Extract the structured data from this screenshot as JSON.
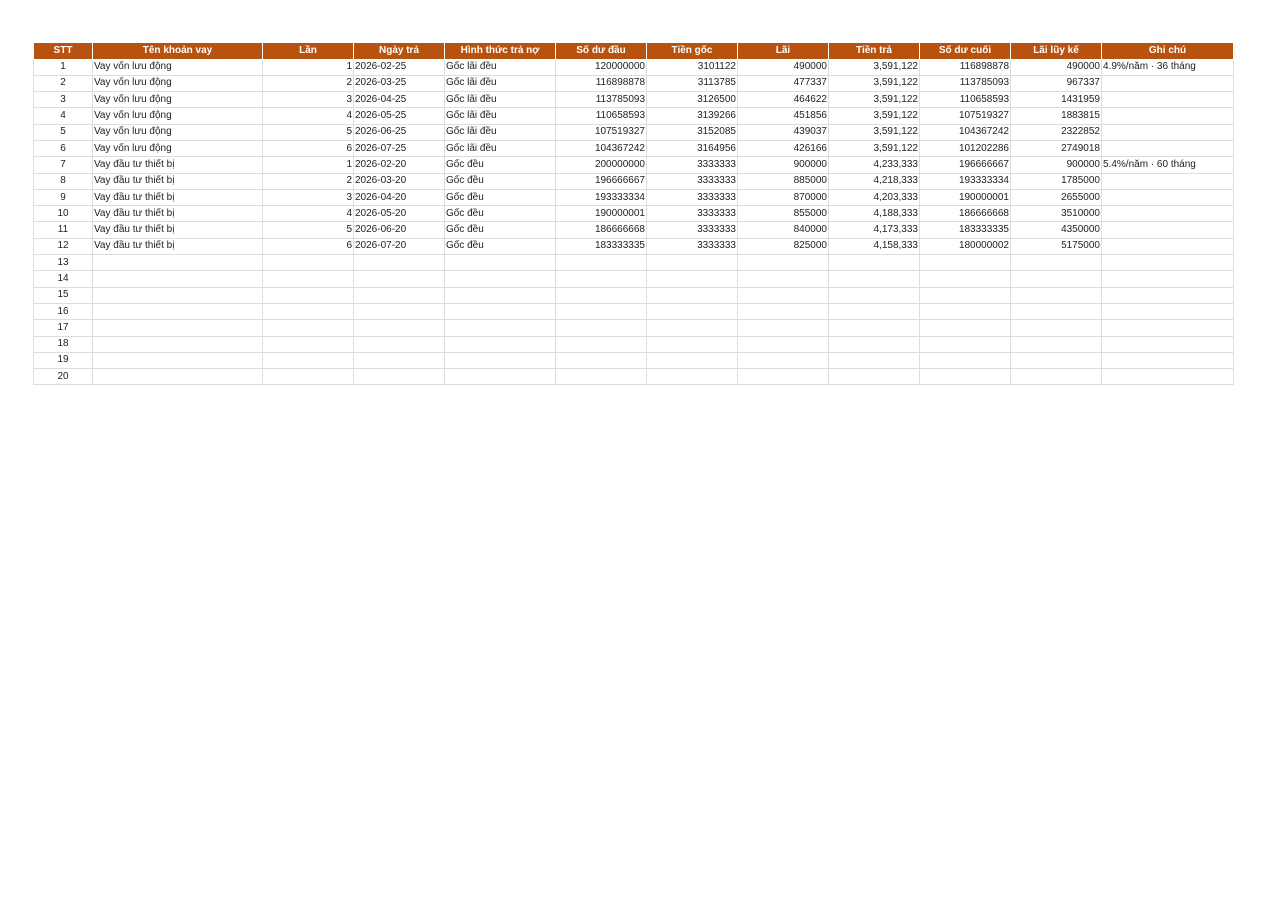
{
  "sheet": {
    "headers": [
      "STT",
      "Tên khoản vay",
      "Lần",
      "Ngày trả",
      "Hình thức trả nợ",
      "Số dư đầu",
      "Tiền gốc",
      "Lãi",
      "Tiền trả",
      "Số dư cuối",
      "Lãi lũy kế",
      "Ghi chú"
    ],
    "header_color": "#b8520f",
    "rows": [
      [
        "1",
        "Vay vốn lưu động",
        "1",
        "2026-02-25",
        "Gốc lãi đều",
        "120000000",
        "3101122",
        "490000",
        "3,591,122",
        "116898878",
        "490000",
        "4.9%/năm · 36 tháng"
      ],
      [
        "2",
        "Vay vốn lưu động",
        "2",
        "2026-03-25",
        "Gốc lãi đều",
        "116898878",
        "3113785",
        "477337",
        "3,591,122",
        "113785093",
        "967337",
        ""
      ],
      [
        "3",
        "Vay vốn lưu động",
        "3",
        "2026-04-25",
        "Gốc lãi đều",
        "113785093",
        "3126500",
        "464622",
        "3,591,122",
        "110658593",
        "1431959",
        ""
      ],
      [
        "4",
        "Vay vốn lưu động",
        "4",
        "2026-05-25",
        "Gốc lãi đều",
        "110658593",
        "3139266",
        "451856",
        "3,591,122",
        "107519327",
        "1883815",
        ""
      ],
      [
        "5",
        "Vay vốn lưu động",
        "5",
        "2026-06-25",
        "Gốc lãi đều",
        "107519327",
        "3152085",
        "439037",
        "3,591,122",
        "104367242",
        "2322852",
        ""
      ],
      [
        "6",
        "Vay vốn lưu động",
        "6",
        "2026-07-25",
        "Gốc lãi đều",
        "104367242",
        "3164956",
        "426166",
        "3,591,122",
        "101202286",
        "2749018",
        ""
      ],
      [
        "7",
        "Vay đầu tư thiết bị",
        "1",
        "2026-02-20",
        "Gốc đều",
        "200000000",
        "3333333",
        "900000",
        "4,233,333",
        "196666667",
        "900000",
        "5.4%/năm · 60 tháng"
      ],
      [
        "8",
        "Vay đầu tư thiết bị",
        "2",
        "2026-03-20",
        "Gốc đều",
        "196666667",
        "3333333",
        "885000",
        "4,218,333",
        "193333334",
        "1785000",
        ""
      ],
      [
        "9",
        "Vay đầu tư thiết bị",
        "3",
        "2026-04-20",
        "Gốc đều",
        "193333334",
        "3333333",
        "870000",
        "4,203,333",
        "190000001",
        "2655000",
        ""
      ],
      [
        "10",
        "Vay đầu tư thiết bị",
        "4",
        "2026-05-20",
        "Gốc đều",
        "190000001",
        "3333333",
        "855000",
        "4,188,333",
        "186666668",
        "3510000",
        ""
      ],
      [
        "11",
        "Vay đầu tư thiết bị",
        "5",
        "2026-06-20",
        "Gốc đều",
        "186666668",
        "3333333",
        "840000",
        "4,173,333",
        "183333335",
        "4350000",
        ""
      ],
      [
        "12",
        "Vay đầu tư thiết bị",
        "6",
        "2026-07-20",
        "Gốc đều",
        "183333335",
        "3333333",
        "825000",
        "4,158,333",
        "180000002",
        "5175000",
        ""
      ],
      [
        "13",
        "",
        "",
        "",
        "",
        "",
        "",
        "",
        "",
        "",
        "",
        ""
      ],
      [
        "14",
        "",
        "",
        "",
        "",
        "",
        "",
        "",
        "",
        "",
        "",
        ""
      ],
      [
        "15",
        "",
        "",
        "",
        "",
        "",
        "",
        "",
        "",
        "",
        "",
        ""
      ],
      [
        "16",
        "",
        "",
        "",
        "",
        "",
        "",
        "",
        "",
        "",
        "",
        ""
      ],
      [
        "17",
        "",
        "",
        "",
        "",
        "",
        "",
        "",
        "",
        "",
        "",
        ""
      ],
      [
        "18",
        "",
        "",
        "",
        "",
        "",
        "",
        "",
        "",
        "",
        "",
        ""
      ],
      [
        "19",
        "",
        "",
        "",
        "",
        "",
        "",
        "",
        "",
        "",
        "",
        ""
      ],
      [
        "20",
        "",
        "",
        "",
        "",
        "",
        "",
        "",
        "",
        "",
        "",
        ""
      ]
    ]
  }
}
